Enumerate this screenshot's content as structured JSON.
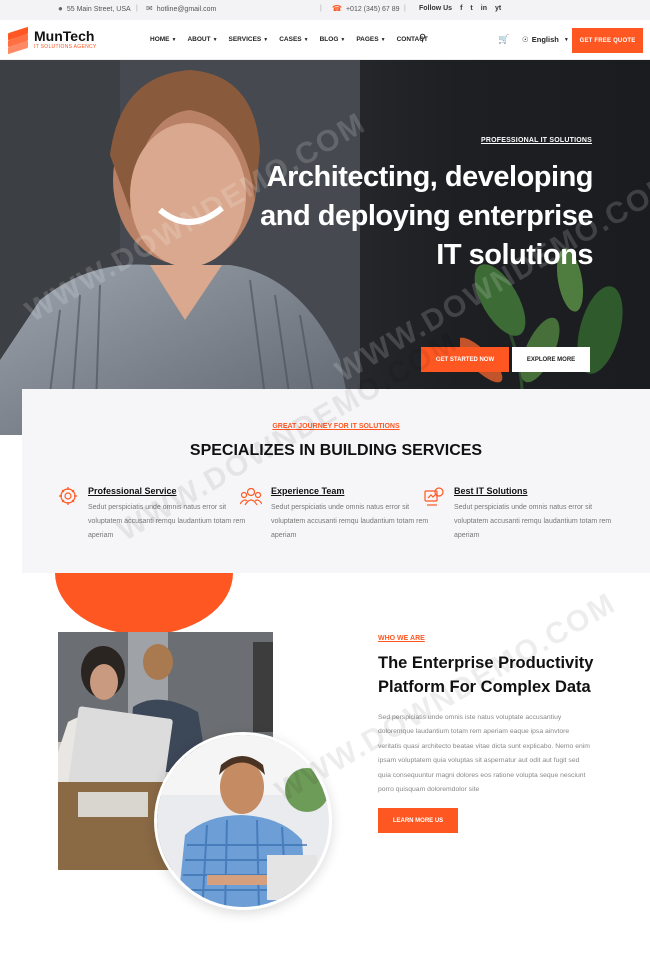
{
  "topbar": {
    "address": "55 Main Street, USA",
    "email": "hotline@gmail.com",
    "phone": "+012 (345) 67 89",
    "follow_label": "Follow Us",
    "social": [
      "f",
      "t",
      "in",
      "yt"
    ]
  },
  "header": {
    "logo_name": "MunTech",
    "logo_tagline": "IT SOLUTIONS AGENCY",
    "nav": [
      {
        "label": "HOME",
        "dropdown": true
      },
      {
        "label": "ABOUT",
        "dropdown": true
      },
      {
        "label": "SERVICES",
        "dropdown": true
      },
      {
        "label": "CASES",
        "dropdown": true
      },
      {
        "label": "BLOG",
        "dropdown": true
      },
      {
        "label": "PAGES",
        "dropdown": true
      },
      {
        "label": "CONTACT",
        "dropdown": false
      }
    ],
    "language": "English",
    "cta": "GET FREE QUOTE"
  },
  "hero": {
    "eyebrow": "PROFESSIONAL IT SOLUTIONS",
    "title_lines": [
      "Architecting, developing",
      "and deploying enterprise",
      "IT solutions"
    ],
    "primary_button": "GET STARTED NOW",
    "secondary_button": "EXPLORE MORE"
  },
  "services": {
    "eyebrow": "GREAT JOURNEY FOR IT SOLUTIONS",
    "title": "SPECIALIZES IN BUILDING SERVICES",
    "items": [
      {
        "name": "Professional Service",
        "description": "Sedut perspiciatis unde omnis natus error sit voluptatem accusanti remqu laudantium totam rem aperiam"
      },
      {
        "name": "Experience Team",
        "description": "Sedut perspiciatis unde omnis natus error sit voluptatem accusanti remqu laudantium totam rem aperiam"
      },
      {
        "name": "Best IT Solutions",
        "description": "Sedut perspiciatis unde omnis natus error sit voluptatem accusanti remqu laudantium totam rem aperiam"
      }
    ]
  },
  "about": {
    "eyebrow": "WHO WE ARE",
    "title": "The Enterprise Productivity Platform For Complex Data",
    "description": "Sed perspiciatis unde omnis iste natus voluptate accusantiuy doloremque laudantium totam rem aperiam eaque ipsa ainvtore veritatis quasi architecto beatae vitae dicta sunt explicabo. Nemo enim ipsam voluptatem quia voluptas sit aspernatur aut odit aut fugit sed quia consequuntur magni dolores eos ratione volupta seque nesciunt porro quisquam doloremdolor site",
    "button": "LEARN MORE US"
  },
  "watermark": "WWW.DOWNDEMO.COM",
  "colors": {
    "accent": "#ff5722",
    "dark": "#111111",
    "panel": "#f6f6f8"
  }
}
